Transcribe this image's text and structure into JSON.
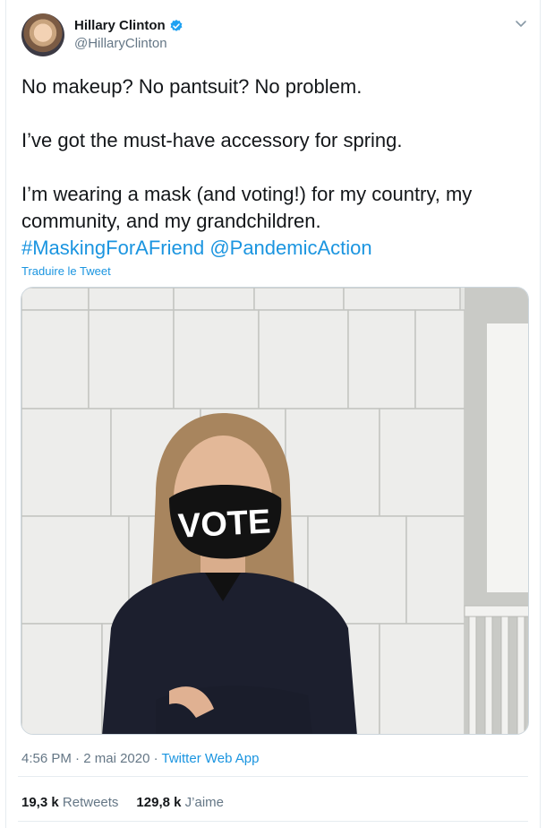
{
  "user": {
    "name": "Hillary Clinton",
    "handle": "@HillaryClinton"
  },
  "tweet": {
    "line1": "No makeup? No pantsuit? No problem.",
    "line2": "I’ve got the must-have accessory for spring.",
    "line3": "I’m wearing a mask (and voting!) for my country, my community, and my grandchildren.",
    "hashtag": "#MaskingForAFriend",
    "mention": "@PandemicAction",
    "translate": "Traduire le Tweet"
  },
  "media": {
    "mask_text": "VOTE"
  },
  "meta": {
    "time": "4:56 PM",
    "date": "2 mai 2020",
    "separator": "·",
    "source": "Twitter Web App"
  },
  "stats": {
    "retweets_count": "19,3 k",
    "retweets_label": "Retweets",
    "likes_count": "129,8 k",
    "likes_label": "J’aime"
  },
  "colors": {
    "link": "#1b95e0",
    "secondary_text": "#657786",
    "verified_badge": "#1da1f2"
  }
}
